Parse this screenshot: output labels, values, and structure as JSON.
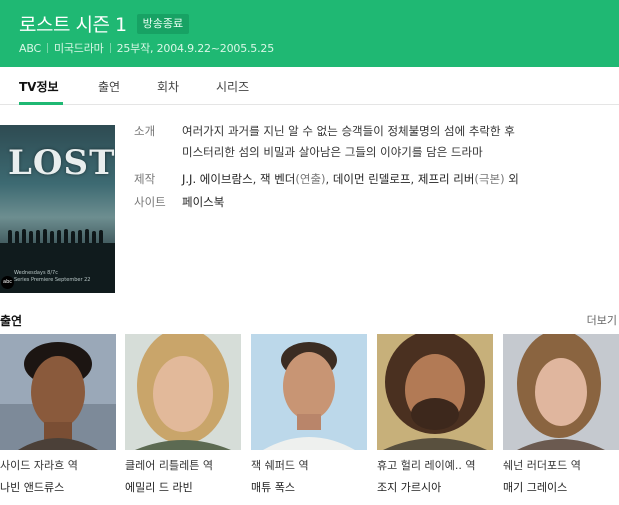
{
  "header": {
    "title": "로스트 시즌 1",
    "badge": "방송종료",
    "meta": {
      "network": "ABC",
      "genre": "미국드라마",
      "episodes_dates": "25부작, 2004.9.22~2005.5.25"
    }
  },
  "tabs": [
    {
      "label": "TV정보",
      "active": true
    },
    {
      "label": "출연",
      "active": false
    },
    {
      "label": "회차",
      "active": false
    },
    {
      "label": "시리즈",
      "active": false
    }
  ],
  "poster": {
    "logo": "LOST",
    "tagline_1": "Wednesdays 8/7c",
    "tagline_2": "Series Premiere September 22",
    "network_logo": "abc"
  },
  "info": {
    "synopsis_label": "소개",
    "synopsis_line1": "여러가지 과거를 지닌 알 수 없는 승객들이 정체불명의 섬에 추락한 후",
    "synopsis_line2": "미스터리한 섬의 비밀과 살아남은 그들의 이야기를 담은 드라마",
    "production_label": "제작",
    "production": {
      "p1": "J.J. 에이브람스",
      "p2": "잭 벤더",
      "p2_role": "(연출)",
      "p3": "데이먼 린델로프",
      "p4": "제프리 리버",
      "p4_role": "(극본)",
      "suffix": "외"
    },
    "site_label": "사이트",
    "site": "페이스북"
  },
  "cast_section": {
    "heading": "출연",
    "more": "더보기",
    "members": [
      {
        "role": "사이드 자라흐 역",
        "name": "나빈 앤드류스"
      },
      {
        "role": "클레어 리틀레튼 역",
        "name": "에밀리 드 라빈"
      },
      {
        "role": "잭 쉐퍼드 역",
        "name": "매튜 폭스"
      },
      {
        "role": "휴고 헐리 레이예.. 역",
        "name": "조지 가르시아"
      },
      {
        "role": "쉐넌 러더포드 역",
        "name": "매기 그레이스"
      }
    ]
  },
  "colors": {
    "header_green": "#1fb873",
    "badge_green": "#17a264"
  }
}
